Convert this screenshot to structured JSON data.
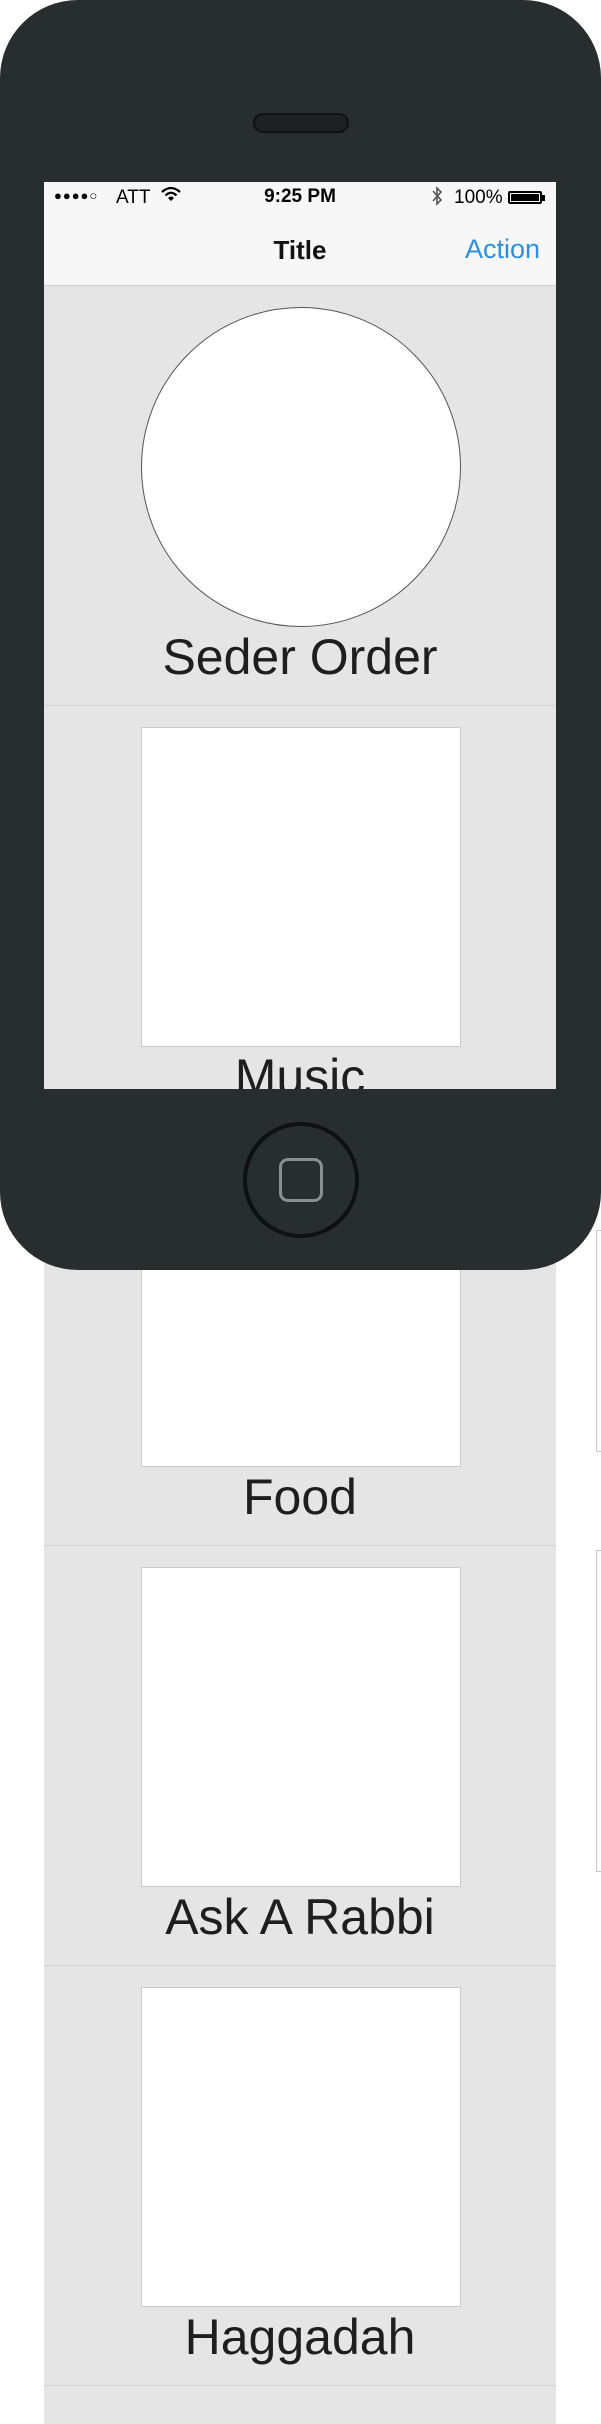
{
  "status_bar": {
    "signal": "●●●●○",
    "carrier": "ATT",
    "wifi_icon": "wifi-icon",
    "time": "9:25 PM",
    "bluetooth_icon": "bluetooth-icon",
    "battery": "100%"
  },
  "navbar": {
    "title": "Title",
    "action": "Action"
  },
  "colors": {
    "accent": "#2c8fe0",
    "phone_body": "#282d2e",
    "background": "#e5e5e5"
  },
  "cells": [
    {
      "label": "Seder Order",
      "shape": "circle"
    },
    {
      "label": "Music",
      "shape": "square"
    },
    {
      "label": "Food",
      "shape": "square"
    },
    {
      "label": "Ask A Rabbi",
      "shape": "square"
    },
    {
      "label": "Haggadah",
      "shape": "square"
    }
  ]
}
